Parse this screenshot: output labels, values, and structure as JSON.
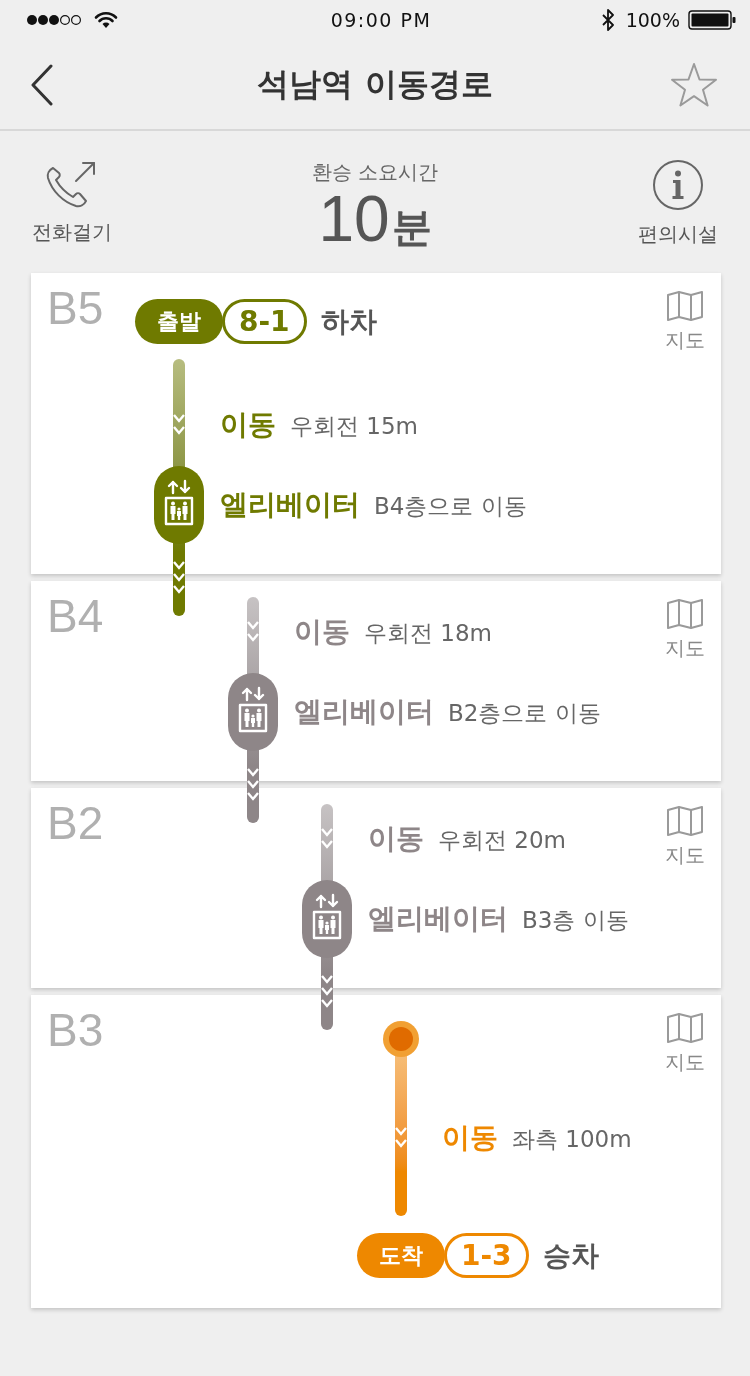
{
  "status_bar": {
    "time": "09:00 PM",
    "battery": "100%"
  },
  "nav_bar": {
    "title": "석남역 이동경로",
    "favorite": false
  },
  "summary": {
    "call_label": "전화걸기",
    "caption": "환승 소요시간",
    "time": "10",
    "unit": "분",
    "facilities_label": "편의시설"
  },
  "floors": [
    {
      "floor": "B5",
      "color": "#6f7a00",
      "start_marker": false,
      "map_label": "지도",
      "steps": [
        {
          "kind": "depart",
          "badge": "출발",
          "platform": "8-1",
          "action": "하차"
        },
        {
          "kind": "walk",
          "title": "이동",
          "detail": "우회전 15m"
        },
        {
          "kind": "elevator",
          "title": "엘리베이터",
          "detail": "B4층으로 이동"
        }
      ]
    },
    {
      "floor": "B4",
      "color": "#8e8688",
      "start_marker": false,
      "map_label": "지도",
      "steps": [
        {
          "kind": "walk",
          "title": "이동",
          "detail": "우회전 18m"
        },
        {
          "kind": "elevator",
          "title": "엘리베이터",
          "detail": "B2층으로 이동"
        }
      ]
    },
    {
      "floor": "B2",
      "color": "#8e8688",
      "start_marker": false,
      "map_label": "지도",
      "steps": [
        {
          "kind": "walk",
          "title": "이동",
          "detail": "우회전 20m"
        },
        {
          "kind": "elevator",
          "title": "엘리베이터",
          "detail": "B3층 이동"
        }
      ]
    },
    {
      "floor": "B3",
      "color": "#ee8800",
      "start_marker": true,
      "map_label": "지도",
      "steps": [
        {
          "kind": "walk",
          "title": "이동",
          "detail": "좌측 100m"
        },
        {
          "kind": "arrive",
          "badge": "도착",
          "platform": "1-3",
          "action": "승차"
        }
      ]
    }
  ]
}
